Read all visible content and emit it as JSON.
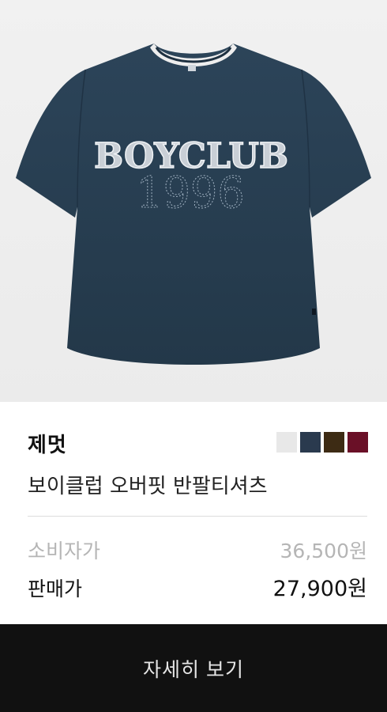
{
  "product": {
    "image_text": {
      "logo_word": "BOYCLUB",
      "logo_year": "1996"
    },
    "brand": "제멋",
    "name": "보이클럽 오버핏 반팔티셔츠",
    "color_swatches": [
      {
        "name": "white",
        "color": "#e8e8e8"
      },
      {
        "name": "navy",
        "color": "#2a3a4e"
      },
      {
        "name": "brown",
        "color": "#3d2b14"
      },
      {
        "name": "burgundy",
        "color": "#6a1027"
      }
    ],
    "price": {
      "list_label": "소비자가",
      "list_value": "36,500원",
      "sale_label": "판매가",
      "sale_value": "27,900원"
    }
  },
  "detail_button_label": "자세히 보기"
}
